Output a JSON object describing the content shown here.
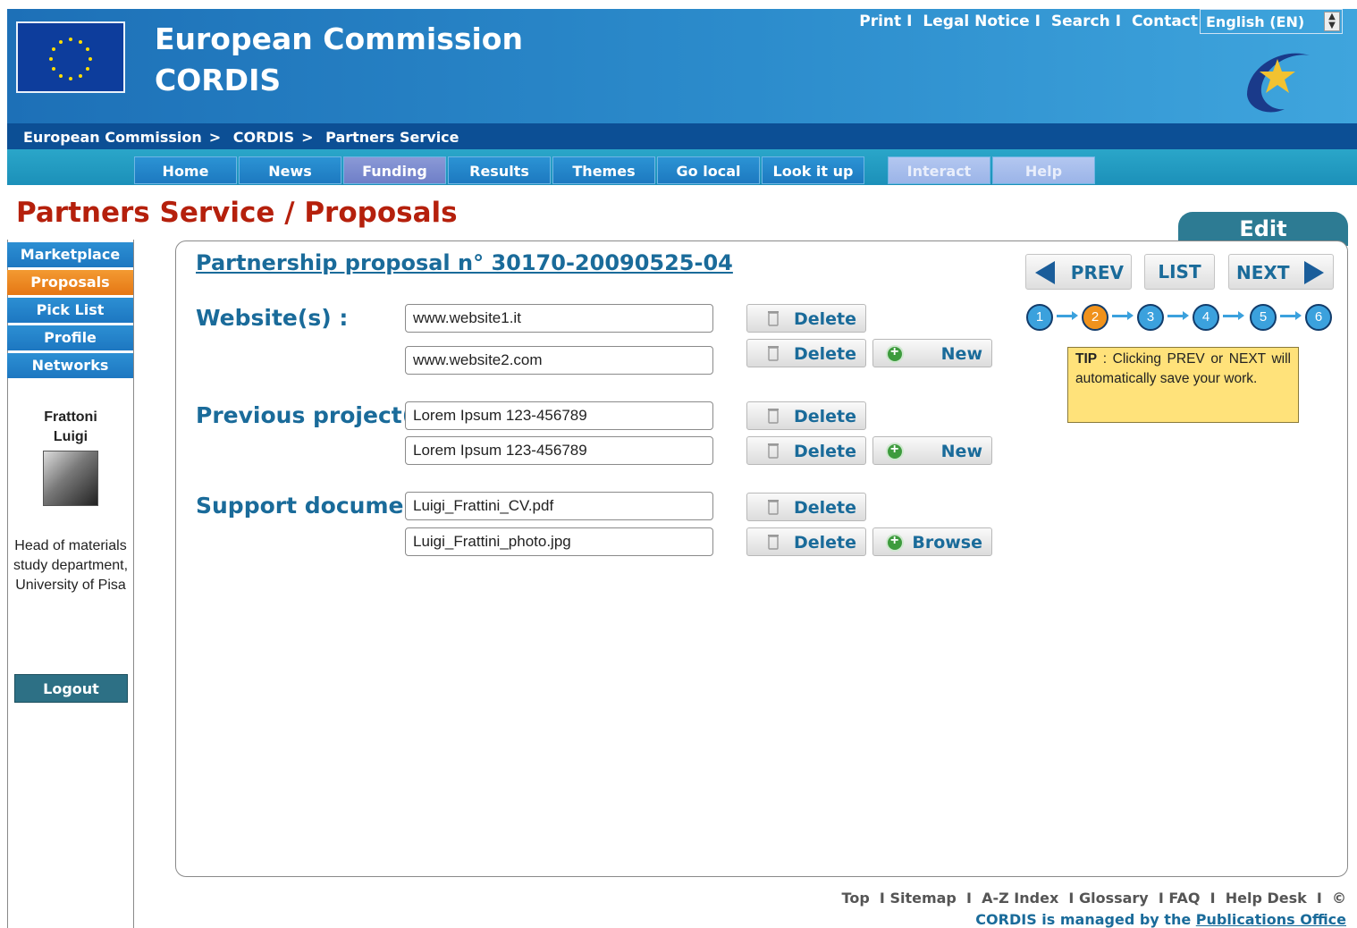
{
  "header": {
    "brand_line1": "European Commission",
    "brand_line2": "CORDIS",
    "top_links": [
      "Print",
      "Legal Notice",
      "Search",
      "Contact"
    ],
    "language": "English (EN)"
  },
  "breadcrumb": [
    "European Commission",
    "CORDIS",
    "Partners Service"
  ],
  "nav": [
    "Home",
    "News",
    "Funding",
    "Results",
    "Themes",
    "Go local",
    "Look it up",
    "Interact",
    "Help"
  ],
  "page_title": "Partners Service / Proposals",
  "edit_tab": "Edit",
  "sidebar": {
    "items": [
      "Marketplace",
      "Proposals",
      "Pick List",
      "Profile",
      "Networks"
    ],
    "user_name_line1": "Frattoni",
    "user_name_line2": "Luigi",
    "user_role": "Head of materials study department, University of Pisa",
    "logout": "Logout"
  },
  "form": {
    "title": "Partnership proposal n° 30170-20090525-04",
    "websites_label": "Website(s) :",
    "websites": [
      "www.website1.it",
      "www.website2.com"
    ],
    "projects_label": "Previous project(s) :",
    "projects": [
      "Lorem Ipsum 123-456789",
      "Lorem Ipsum 123-456789"
    ],
    "documents_label": "Support documents :",
    "documents": [
      "Luigi_Frattini_CV.pdf",
      "Luigi_Frattini_photo.jpg"
    ],
    "delete_label": "Delete",
    "new_label": "New",
    "browse_label": "Browse"
  },
  "pager": {
    "prev": "PREV",
    "list": "LIST",
    "next": "NEXT",
    "steps": [
      "1",
      "2",
      "3",
      "4",
      "5",
      "6"
    ],
    "current_step": "2"
  },
  "tip": {
    "label": "TIP",
    "text": " : Clicking PREV or NEXT will automatically save your work."
  },
  "footer": {
    "links": [
      "Top",
      "Sitemap",
      "A-Z Index",
      "Glossary",
      "FAQ",
      "Help Desk"
    ],
    "copyright": "©",
    "managed_prefix": "CORDIS is managed by the",
    "managed_link": "Publications Office"
  },
  "colors": {
    "header_blue": "#1d70b7",
    "title_red": "#b5200c",
    "link_blue": "#1a6b9a",
    "active_orange": "#f0921c",
    "tip_yellow": "#ffe27a"
  }
}
